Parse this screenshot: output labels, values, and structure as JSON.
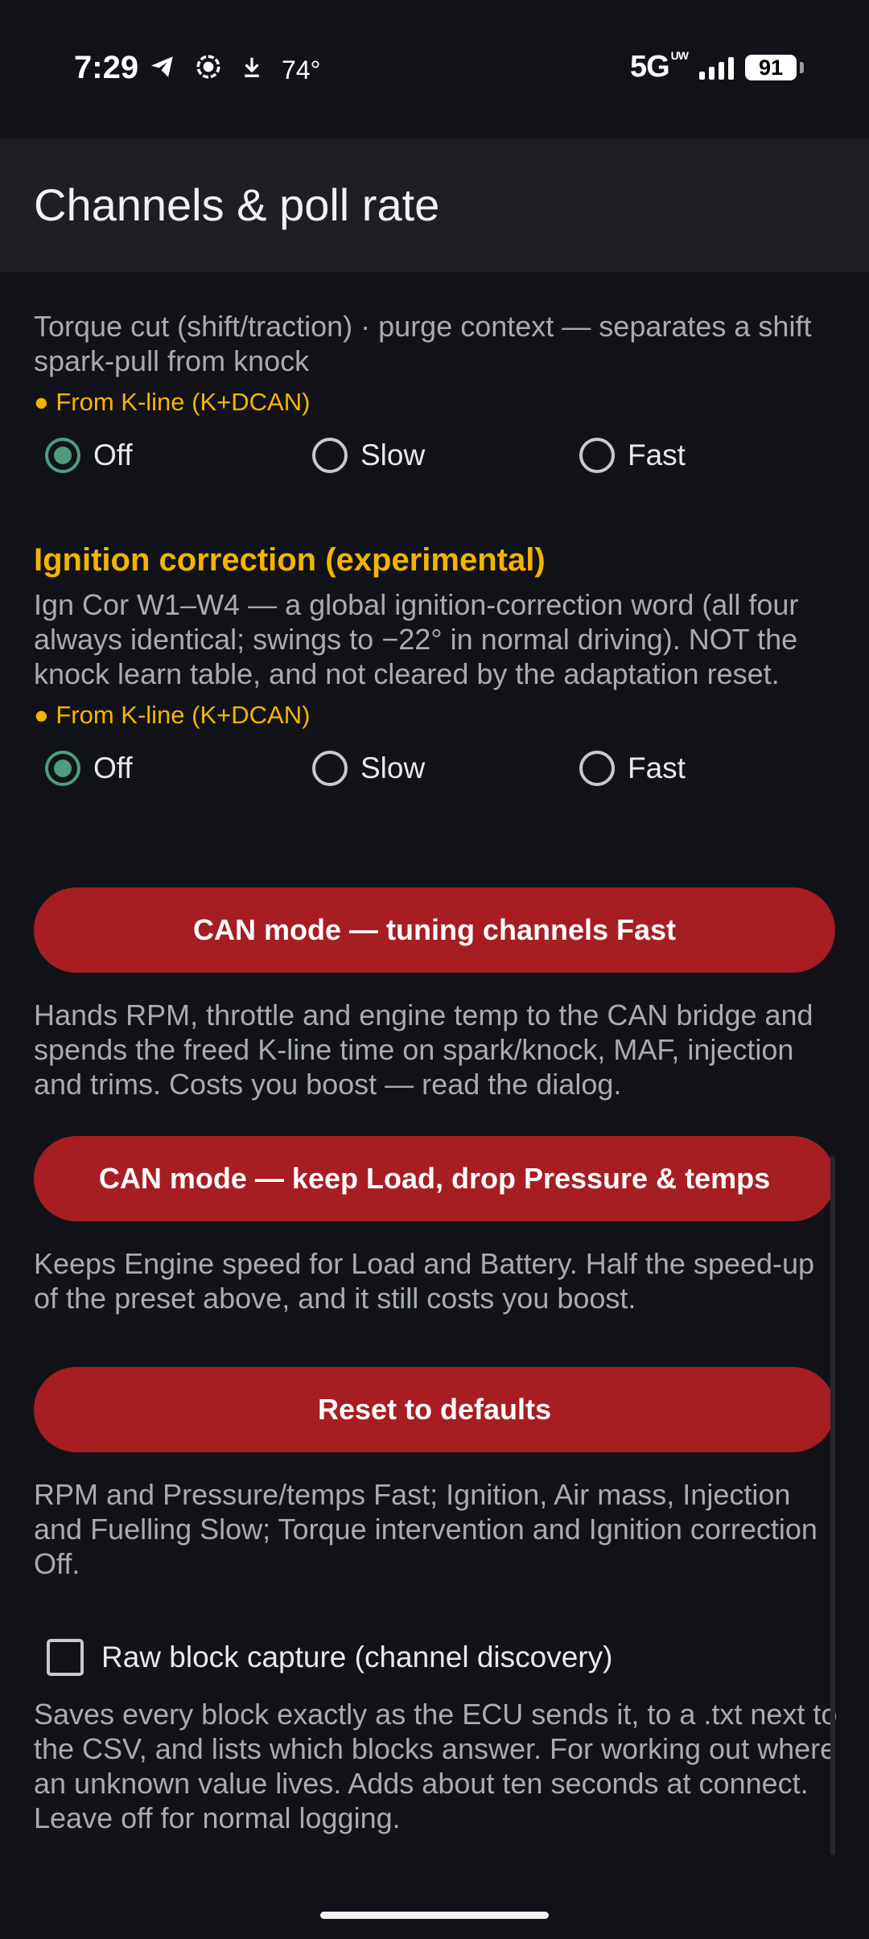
{
  "status_bar": {
    "time": "7:29",
    "temperature": "74°",
    "network": "5G",
    "network_sub": "UW",
    "battery": "91"
  },
  "app_bar": {
    "title": "Channels & poll rate"
  },
  "torque": {
    "description": "Torque cut (shift/traction) · purge context — separates a shift spark-pull from knock",
    "source": "● From K-line (K+DCAN)",
    "options": [
      "Off",
      "Slow",
      "Fast"
    ],
    "selected": "Off"
  },
  "ignition_correction": {
    "title": "Ignition correction (experimental)",
    "description": "Ign Cor W1–W4 — a global ignition-correction word (all four always identical; swings to −22° in normal driving). NOT the knock learn table, and not cleared by the adaptation reset.",
    "source": "● From K-line (K+DCAN)",
    "options": [
      "Off",
      "Slow",
      "Fast"
    ],
    "selected": "Off"
  },
  "can_fast": {
    "button_label": "CAN mode — tuning channels Fast",
    "description": "Hands RPM, throttle and engine temp to the CAN bridge and spends the freed K-line time on spark/knock, MAF, injection and trims. Costs you boost — read the dialog."
  },
  "can_keep_load": {
    "button_label": "CAN mode — keep Load, drop Pressure & temps",
    "description": "Keeps Engine speed for Load and Battery. Half the speed-up of the preset above, and it still costs you boost."
  },
  "reset": {
    "button_label": "Reset to defaults",
    "description": "RPM and Pressure/temps Fast; Ignition, Air mass, Injection and Fuelling Slow; Torque intervention and Ignition correction Off."
  },
  "raw_capture": {
    "label": "Raw block capture (channel discovery)",
    "checked": false,
    "description": "Saves every block exactly as the ECU sends it, to a .txt next to the CSV, and lists which blocks answer. For working out where an unknown value lives. Adds about ten seconds at connect. Leave off for normal logging."
  },
  "colors": {
    "background": "#111318",
    "app_bar": "#1e1f24",
    "accent_amber": "#f5b400",
    "button_red": "#a61e22",
    "radio_selected": "#4f9b7e"
  }
}
